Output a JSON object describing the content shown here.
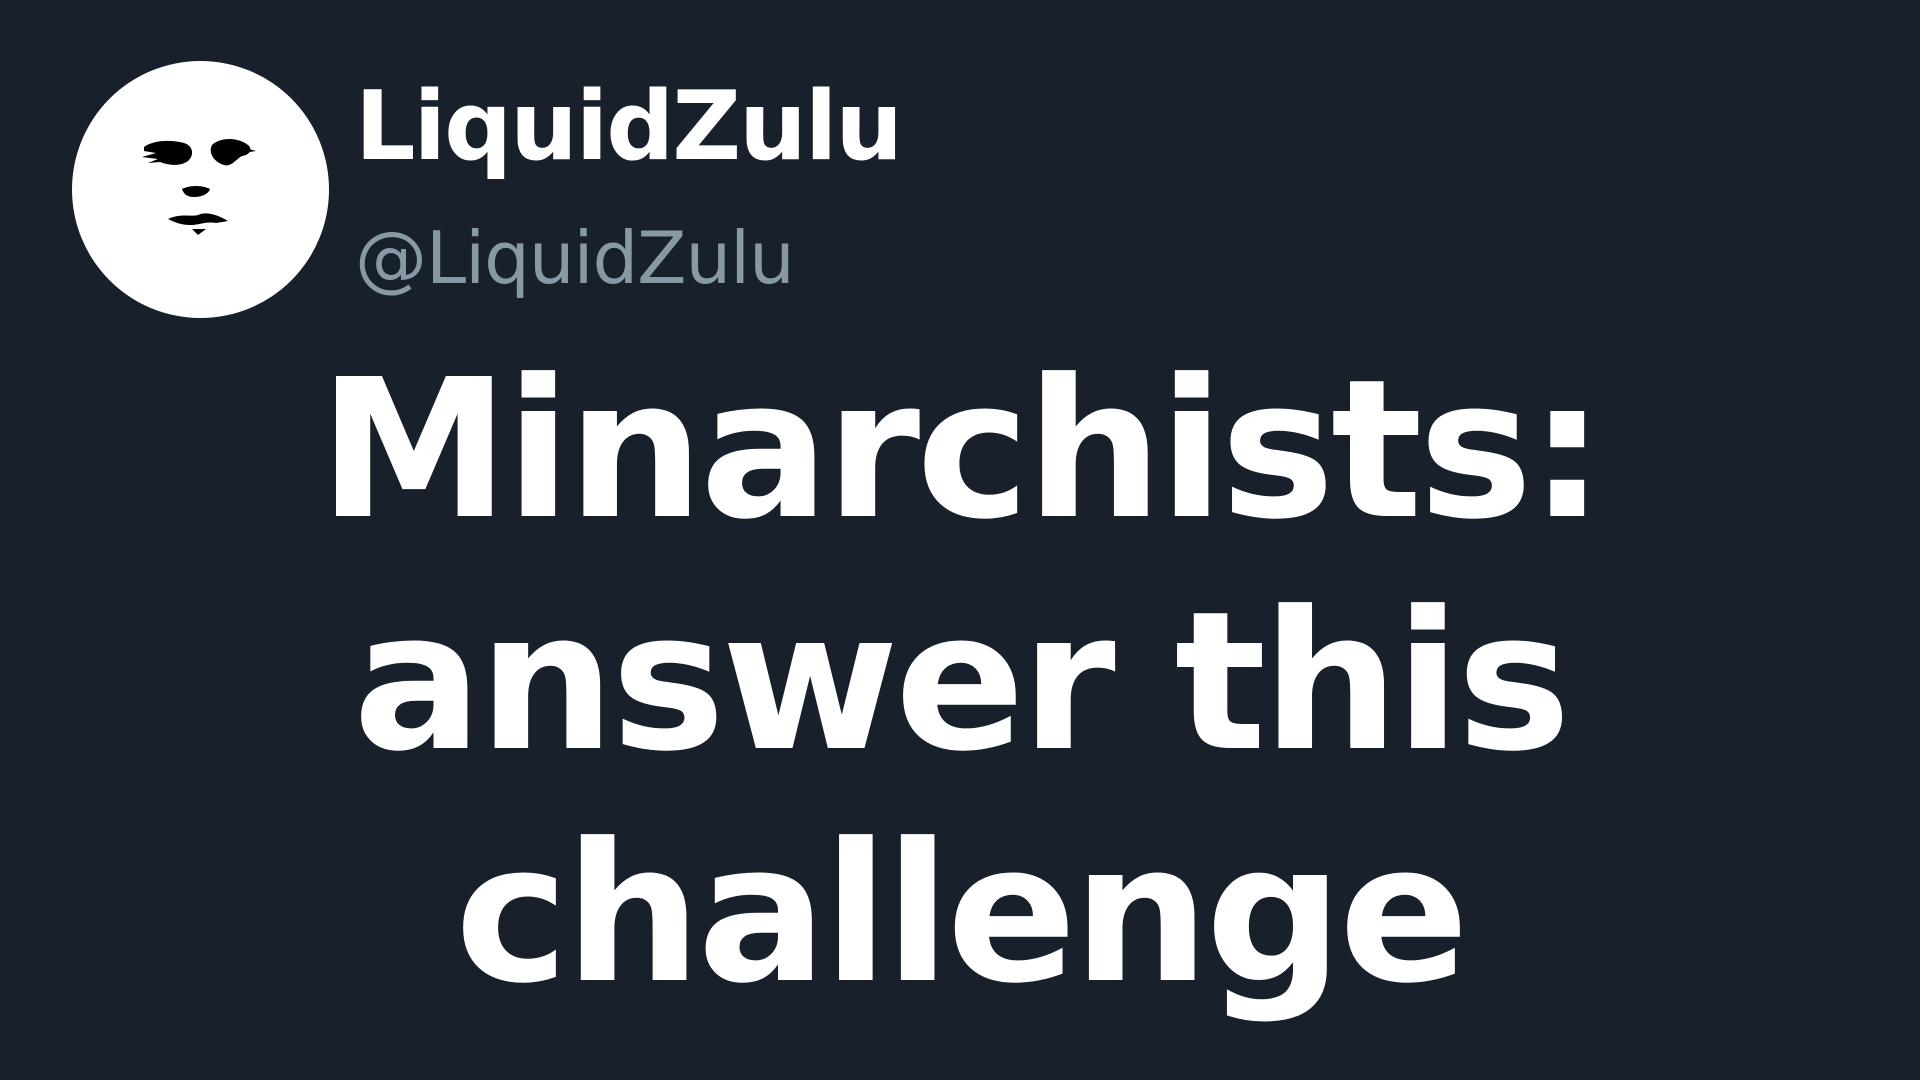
{
  "profile": {
    "display_name": "LiquidZulu",
    "handle": "@LiquidZulu",
    "avatar_icon": "face-avatar-icon"
  },
  "headline": {
    "lines": [
      "Minarchists:",
      "answer this",
      "challenge"
    ]
  },
  "colors": {
    "background": "#17202b",
    "name_text": "#ffffff",
    "handle_text": "#8899a6",
    "headline_text": "#ffffff",
    "avatar_bg": "#ffffff",
    "avatar_features": "#000000"
  }
}
